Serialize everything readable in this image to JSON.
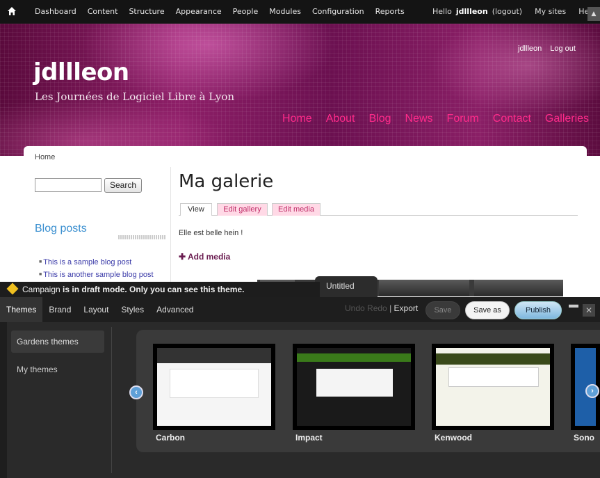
{
  "admin_bar": {
    "nav": [
      "Dashboard",
      "Content",
      "Structure",
      "Appearance",
      "People",
      "Modules",
      "Configuration",
      "Reports"
    ],
    "hello": "Hello",
    "username": "jdllleon",
    "logout": "(logout)",
    "my_sites": "My sites",
    "help": "Help"
  },
  "site": {
    "title": "jdllleon",
    "slogan": "Les Journées de Logiciel Libre à Lyon",
    "user_links": [
      "jdllleon",
      "Log out"
    ],
    "main_menu": [
      "Home",
      "About",
      "Blog",
      "News",
      "Forum",
      "Contact",
      "Galleries"
    ]
  },
  "page": {
    "breadcrumb": "Home",
    "search_button": "Search",
    "blog_heading": "Blog posts",
    "blog_posts": [
      "This is a sample blog post",
      "This is another sample blog post"
    ],
    "title": "Ma galerie",
    "tabs": [
      "View",
      "Edit gallery",
      "Edit media"
    ],
    "body": "Elle est belle hein !",
    "add_media": "Add media"
  },
  "draft_bar": {
    "prefix": "Campaign",
    "message": "is in draft mode. Only you can see this theme."
  },
  "theme_editor": {
    "untitled": "Untitled",
    "tabs": [
      "Themes",
      "Brand",
      "Layout",
      "Styles",
      "Advanced"
    ],
    "undo": "Undo",
    "redo": "Redo",
    "export": "Export",
    "save": "Save",
    "save_as": "Save as",
    "publish": "Publish",
    "sidebar": [
      "Gardens themes",
      "My themes"
    ],
    "themes": [
      "Carbon",
      "Impact",
      "Kenwood",
      "Sono"
    ]
  }
}
